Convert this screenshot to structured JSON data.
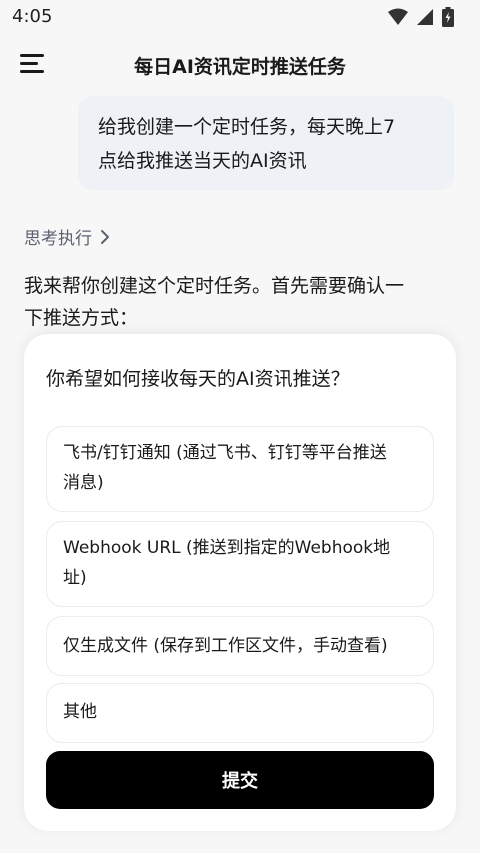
{
  "status_bar": {
    "time": "4:05",
    "icons": [
      "wifi-icon",
      "cellular-signal-icon",
      "battery-icon"
    ]
  },
  "header": {
    "title": "每日AI资讯定时推送任务",
    "menu_icon": "hamburger-menu-icon"
  },
  "chat": {
    "user_message_line1": "给我创建一个定时任务，每天晚上7",
    "user_message_line2": "点给我推送当天的AI资讯",
    "thinking_label": "思考执行",
    "assistant_line1": "我来帮你创建这个定时任务。首先需要确认一",
    "assistant_line2": "下推送方式："
  },
  "question_card": {
    "question": "你希望如何接收每天的AI资讯推送？",
    "options": [
      {
        "line1": "飞书/钉钉通知 (通过飞书、钉钉等平台推送",
        "line2": "消息)"
      },
      {
        "line1": "Webhook URL (推送到指定的Webhook地",
        "line2": "址)"
      },
      {
        "line1": "仅生成文件 (保存到工作区文件，手动查看)"
      },
      {
        "line1": "其他"
      }
    ],
    "submit_label": "提交"
  },
  "colors": {
    "background": "#f7f7f8",
    "user_bubble": "#eef1f6",
    "primary_button": "#000000",
    "muted_text": "#5b6270"
  }
}
